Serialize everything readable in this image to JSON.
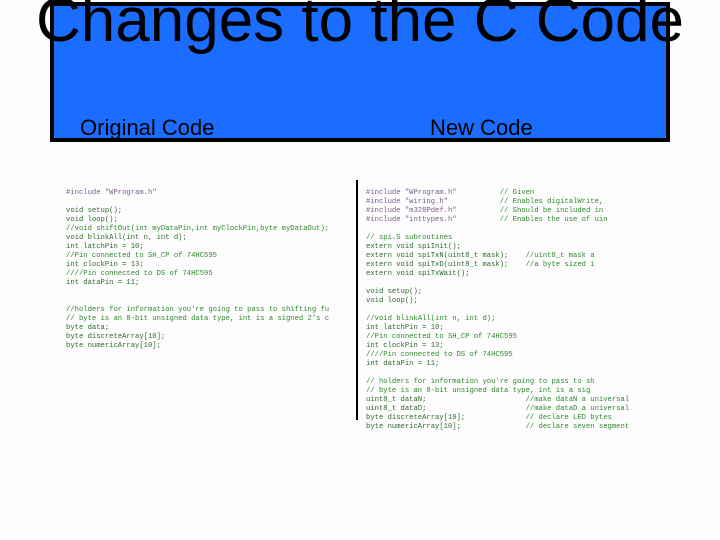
{
  "header": {
    "title": "Changes to the C Code",
    "sub_left": "Original Code",
    "sub_right": "New Code"
  },
  "code_left": {
    "l01": "#include \"WProgram.h\"",
    "l02": "void setup();",
    "l03": "void loop();",
    "l04": "//void shiftOut(int myDataPin,int myClockPin,byte myDataOut);",
    "l05": "void blinkAll(int n, int d);",
    "l06": "int latchPin = 10;",
    "l07": "//Pin connected to SH_CP of 74HC595",
    "l08": "int clockPin = 13;",
    "l09": "////Pin connected to DS of 74HC595",
    "l10": "int dataPin = 11;",
    "l11": "",
    "l12": "//holders for information you're going to pass to shifting fu",
    "l13": "// byte is an 8-bit unsigned data type, int is a signed 2's c",
    "l14": "byte data;",
    "l15": "byte discreteArray[10];",
    "l16": "byte numericArray[10];"
  },
  "code_right": {
    "l01a": "#include \"WProgram.h\"",
    "l01b": "// Given",
    "l02a": "#include \"wiring.h\"",
    "l02b": "// Enables digitalWrite,",
    "l03a": "#include \"m328Pdef.h\"",
    "l03b": "// Should be included in",
    "l04a": "#include \"inttypes.h\"",
    "l04b": "// Enables the use of uin",
    "l05": "",
    "l06": "// spi.S subroutines",
    "l07a": "extern void spiInit();",
    "l08a": "extern void spiTxN(uint8_t mask);",
    "l08b": "//uint8_t mask a",
    "l09a": "extern void spiTxD(uint8_t mask);",
    "l09b": "//a byte sized i",
    "l10a": "extern void spiTxWait();",
    "l11": "",
    "l12": "void setup();",
    "l13": "void loop();",
    "l14": "",
    "l15": "//void blinkAll(int n, int d);",
    "l16": "int latchPin = 10;",
    "l17": "//Pin connected to SH_CP of 74HC595",
    "l18": "int clockPin = 13;",
    "l19": "////Pin connected to DS of 74HC595",
    "l20": "int dataPin = 11;",
    "l21": "",
    "l22": "// holders for information you're going to pass to sh",
    "l23": "// byte is an 8-bit unsigned data type, int is a sig",
    "l24a": "uint8_t dataN;",
    "l24b": "//make dataN a universal",
    "l25a": "uint8_t dataD;",
    "l25b": "//make dataD a universal",
    "l26a": "byte discreteArray[10];",
    "l26b": "// declare LED bytes",
    "l27a": "byte numericArray[10];",
    "l27b": "// declare seven segment"
  }
}
